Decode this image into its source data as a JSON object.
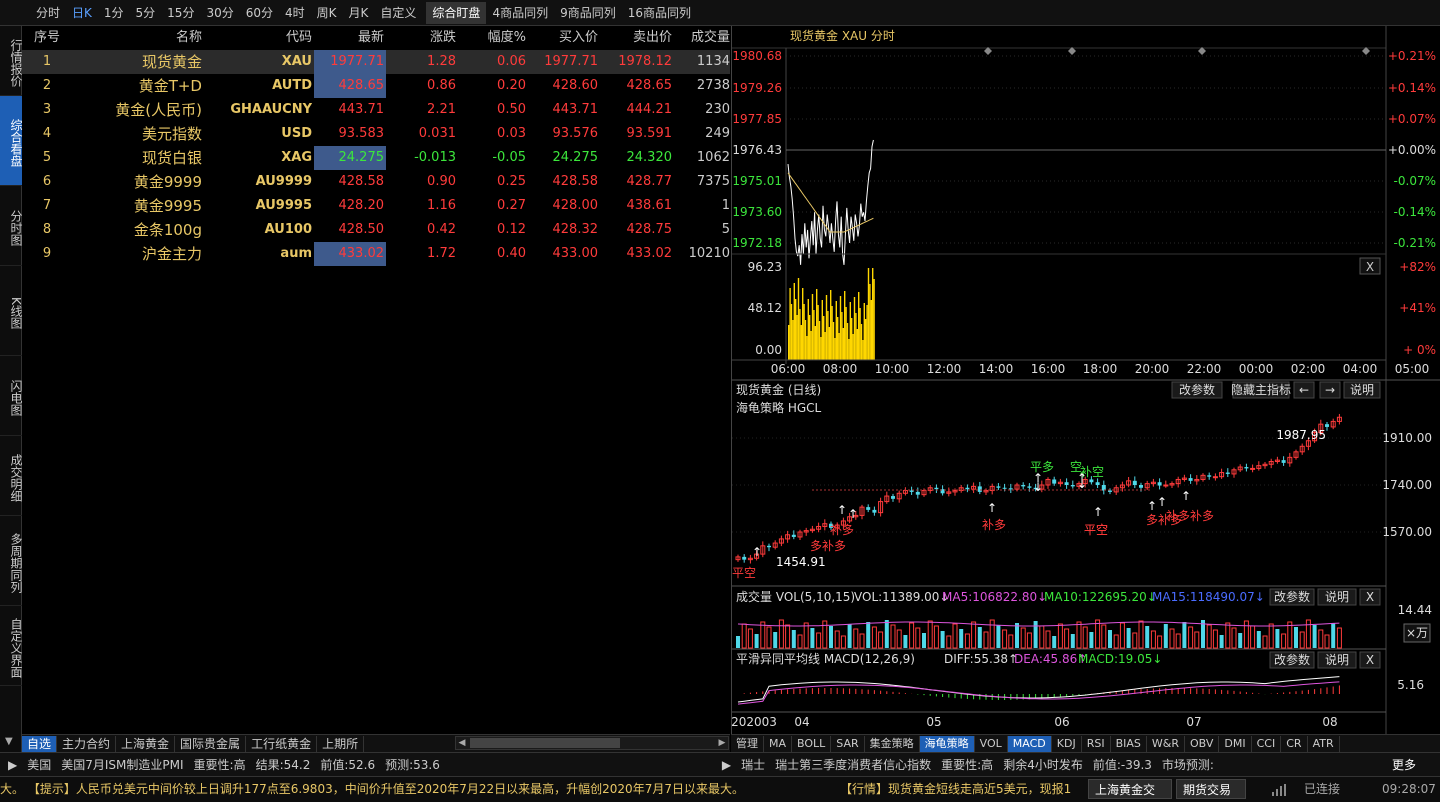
{
  "toolbar": {
    "periods": [
      "分时",
      "日K",
      "1分",
      "5分",
      "15分",
      "30分",
      "60分",
      "4时",
      "周K",
      "月K",
      "自定义"
    ],
    "active_period": 1,
    "views": [
      "综合盯盘",
      "4商品同列",
      "9商品同列",
      "16商品同列"
    ],
    "active_view": 0
  },
  "sidebar": {
    "items": [
      "行情报价",
      "综合看盘",
      "分时图",
      "K线图",
      "闪电图",
      "成交明细",
      "多周期同列",
      "自定义界面"
    ],
    "active": 1
  },
  "quote_table": {
    "headers": [
      "序号",
      "名称",
      "代码",
      "最新",
      "涨跌",
      "幅度%",
      "买入价",
      "卖出价",
      "成交量"
    ],
    "rows": [
      {
        "no": "1",
        "name": "现货黄金",
        "code": "XAU",
        "last": "1977.71",
        "chg": "1.28",
        "pct": "0.06",
        "bid": "1977.71",
        "ask": "1978.12",
        "vol": "1134",
        "dir": "up"
      },
      {
        "no": "2",
        "name": "黄金T+D",
        "code": "AUTD",
        "last": "428.65",
        "chg": "0.86",
        "pct": "0.20",
        "bid": "428.60",
        "ask": "428.65",
        "vol": "2738",
        "dir": "up"
      },
      {
        "no": "3",
        "name": "黄金(人民币)",
        "code": "GHAAUCNY",
        "last": "443.71",
        "chg": "2.21",
        "pct": "0.50",
        "bid": "443.71",
        "ask": "444.21",
        "vol": "230",
        "dir": "up"
      },
      {
        "no": "4",
        "name": "美元指数",
        "code": "USD",
        "last": "93.583",
        "chg": "0.031",
        "pct": "0.03",
        "bid": "93.576",
        "ask": "93.591",
        "vol": "249",
        "dir": "up"
      },
      {
        "no": "5",
        "name": "现货白银",
        "code": "XAG",
        "last": "24.275",
        "chg": "-0.013",
        "pct": "-0.05",
        "bid": "24.275",
        "ask": "24.320",
        "vol": "1062",
        "dir": "dn"
      },
      {
        "no": "6",
        "name": "黄金9999",
        "code": "AU9999",
        "last": "428.58",
        "chg": "0.90",
        "pct": "0.25",
        "bid": "428.58",
        "ask": "428.77",
        "vol": "7375",
        "dir": "up"
      },
      {
        "no": "7",
        "name": "黄金9995",
        "code": "AU9995",
        "last": "428.20",
        "chg": "1.16",
        "pct": "0.27",
        "bid": "428.00",
        "ask": "438.61",
        "vol": "1",
        "dir": "up"
      },
      {
        "no": "8",
        "name": "金条100g",
        "code": "AU100",
        "last": "428.50",
        "chg": "0.42",
        "pct": "0.12",
        "bid": "428.32",
        "ask": "428.75",
        "vol": "5",
        "dir": "up"
      },
      {
        "no": "9",
        "name": "沪金主力",
        "code": "aum",
        "last": "433.02",
        "chg": "1.72",
        "pct": "0.40",
        "bid": "433.00",
        "ask": "433.02",
        "vol": "10210",
        "dir": "up"
      }
    ]
  },
  "bottom_tabs": {
    "items": [
      "自选",
      "主力合约",
      "上海黄金",
      "国际贵金属",
      "工行纸黄金",
      "上期所"
    ],
    "active": 0
  },
  "intraday": {
    "title": "现货黄金 XAU 分时",
    "price_ticks": [
      "1980.68",
      "1979.26",
      "1977.85",
      "1976.43",
      "1975.01",
      "1973.60",
      "1972.18"
    ],
    "pct_ticks": [
      "+0.21%",
      "+0.14%",
      "+0.07%",
      "+0.00%",
      "-0.07%",
      "-0.14%",
      "-0.21%"
    ],
    "vol_ticks": [
      "96.23",
      "48.12",
      "0.00"
    ],
    "vol_pct_ticks": [
      "+82%",
      "+41%",
      "+ 0%"
    ],
    "time_ticks": [
      "06:00",
      "08:00",
      "10:00",
      "12:00",
      "14:00",
      "16:00",
      "18:00",
      "20:00",
      "22:00",
      "00:00",
      "02:00",
      "04:00",
      "05:00"
    ],
    "close_label": "X"
  },
  "kline": {
    "title": "现货黄金 (日线)",
    "buttons": [
      "改参数",
      "隐藏主指标",
      "←",
      "→",
      "说明"
    ],
    "strategy": "海龟策略 HGCL",
    "price_ticks": [
      "1910.00",
      "1740.00",
      "1570.00"
    ],
    "high_label": "1987.95",
    "low_label": "1454.91",
    "annotations": [
      "平空",
      "多补多",
      "补多",
      "补多",
      "平多",
      "平空",
      "空",
      "补空",
      "平空",
      "多补多",
      "补多",
      "补多"
    ],
    "date_ticks": [
      "202003",
      "04",
      "05",
      "06",
      "07",
      "08"
    ]
  },
  "volume": {
    "title": "成交量 VOL(5,10,15)",
    "vol": "VOL:11389.00↓",
    "ma5": "MA5:106822.80↓",
    "ma10": "MA10:122695.20↓",
    "ma15": "MA15:118490.07↓",
    "buttons": [
      "改参数",
      "说明",
      "X"
    ],
    "tick": "14.44",
    "unit": "×万"
  },
  "macd": {
    "title": "平滑异同平均线 MACD(12,26,9)",
    "diff": "DIFF:55.38↑",
    "dea": "DEA:45.86↑",
    "macd": "MACD:19.05↓",
    "buttons": [
      "改参数",
      "说明",
      "X"
    ],
    "tick": "5.16"
  },
  "indicator_tabs": {
    "items": [
      "管理",
      "MA",
      "BOLL",
      "SAR",
      "集金策略",
      "海龟策略",
      "VOL",
      "MACD",
      "KDJ",
      "RSI",
      "BIAS",
      "W&R",
      "OBV",
      "DMI",
      "CCI",
      "CR",
      "ATR"
    ],
    "active": [
      5,
      7
    ]
  },
  "news_bar": {
    "left_country": "美国",
    "left_event": "美国7月ISM制造业PMI",
    "left_importance": "重要性:高",
    "left_result": "结果:54.2",
    "left_prev": "前值:52.6",
    "left_forecast": "预测:53.6",
    "right_country": "瑞士",
    "right_event": "瑞士第三季度消费者信心指数",
    "right_importance": "重要性:高",
    "right_remaining": "剩余4小时发布",
    "right_prev": "前值:-39.3",
    "right_forecast": "市场预测:",
    "more": "更多"
  },
  "ticker": {
    "text1": "大。 【提示】人民币兑美元中间价较上日调升177点至6.9803，中间价升值至2020年7月22日以来最高，升幅创2020年7月7日以来最大。",
    "text2": "【行情】现货黄金短线走高近5美元，现报1",
    "btn1": "上海黄金交易",
    "btn2": "期货交易",
    "status": "已连接",
    "time": "09:28:07"
  },
  "colors": {
    "up": "#ff3b3b",
    "down": "#3ce63c",
    "accent": "#1e5fb5",
    "gold": "#e8c766"
  }
}
